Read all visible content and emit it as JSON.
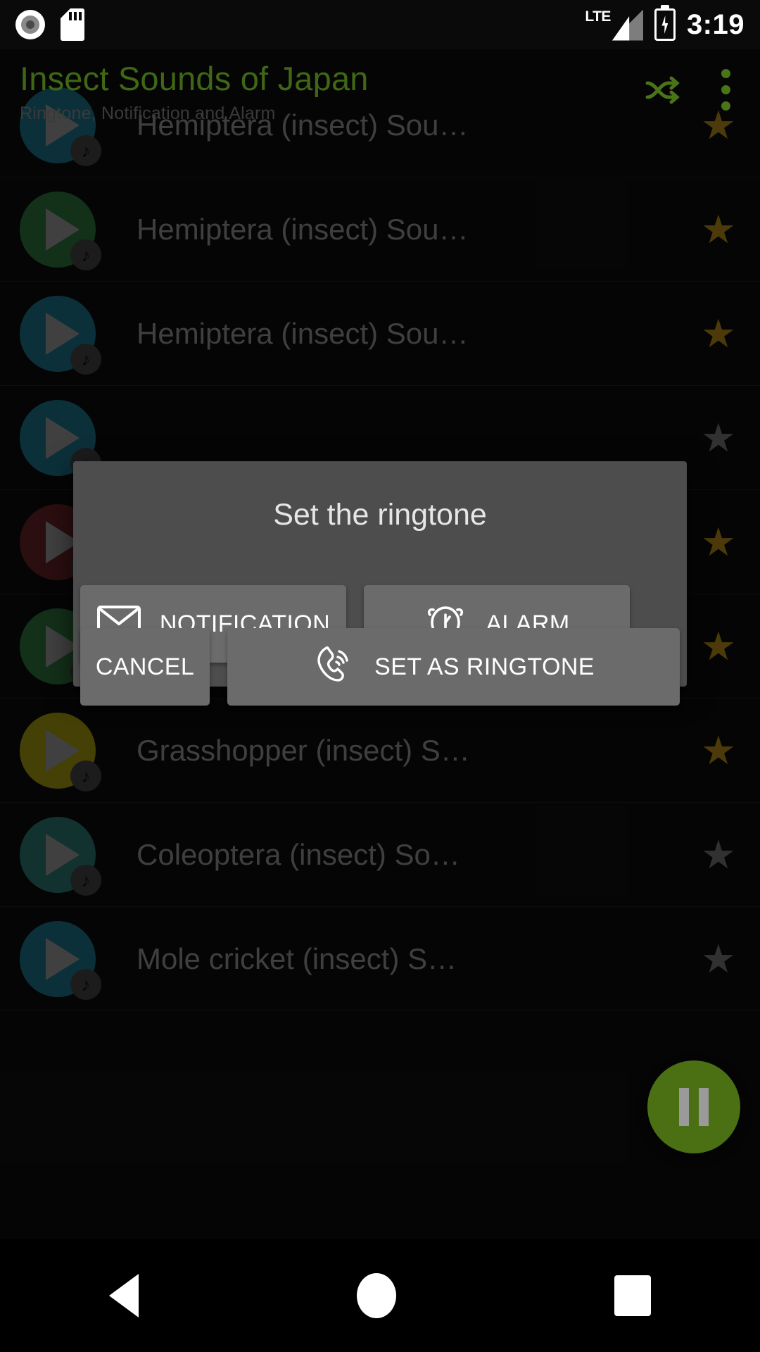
{
  "status_bar": {
    "icons": [
      "record-icon",
      "sd-card-icon",
      "lte-signal-icon",
      "battery-charging-icon"
    ],
    "network_label": "LTE",
    "time": "3:19"
  },
  "app_bar": {
    "title": "Insect Sounds of Japan",
    "subtitle": "Ringtone, Notification and Alarm",
    "accent_color": "#4b7418",
    "actions": [
      "shuffle-icon",
      "overflow-menu-icon"
    ]
  },
  "list": {
    "rows": [
      {
        "title": "Hemiptera (insect) Sou…",
        "disc_color": "#1c6a80",
        "starred": true,
        "star": "★"
      },
      {
        "title": "Hemiptera (insect) Sou…",
        "disc_color": "#2a6b38",
        "starred": true,
        "star": "★"
      },
      {
        "title": "Hemiptera (insect) Sou…",
        "disc_color": "#1c6a80",
        "starred": true,
        "star": "★"
      },
      {
        "title": "",
        "disc_color": "#1c6a80",
        "starred": false,
        "star": "★"
      },
      {
        "title": "",
        "disc_color": "#5f1f23",
        "starred": true,
        "star": "★"
      },
      {
        "title": "",
        "disc_color": "#2a6b38",
        "starred": true,
        "star": "★"
      },
      {
        "title": "Grasshopper (insect) S…",
        "disc_color": "#9a8e0e",
        "starred": true,
        "star": "★"
      },
      {
        "title": "Coleoptera (insect) So…",
        "disc_color": "#28706c",
        "starred": false,
        "star": "★"
      },
      {
        "title": "Mole cricket (insect) S…",
        "disc_color": "#1c6a80",
        "starred": false,
        "star": "★"
      }
    ],
    "note_badge": "♪"
  },
  "fab": {
    "icon": "pause-icon",
    "color": "#4b7014"
  },
  "dialog": {
    "title": "Set the ringtone",
    "buttons": {
      "notification": {
        "label": "NOTIFICATION",
        "icon": "envelope-icon"
      },
      "alarm": {
        "label": "ALARM",
        "icon": "alarm-clock-icon"
      },
      "cancel": {
        "label": "CANCEL",
        "icon": "none"
      },
      "set_ringtone": {
        "label": "SET AS RINGTONE",
        "icon": "phone-ringing-icon"
      }
    }
  },
  "nav_bar": {
    "back": "back-triangle-icon",
    "home": "home-circle-icon",
    "recents": "recents-square-icon"
  }
}
